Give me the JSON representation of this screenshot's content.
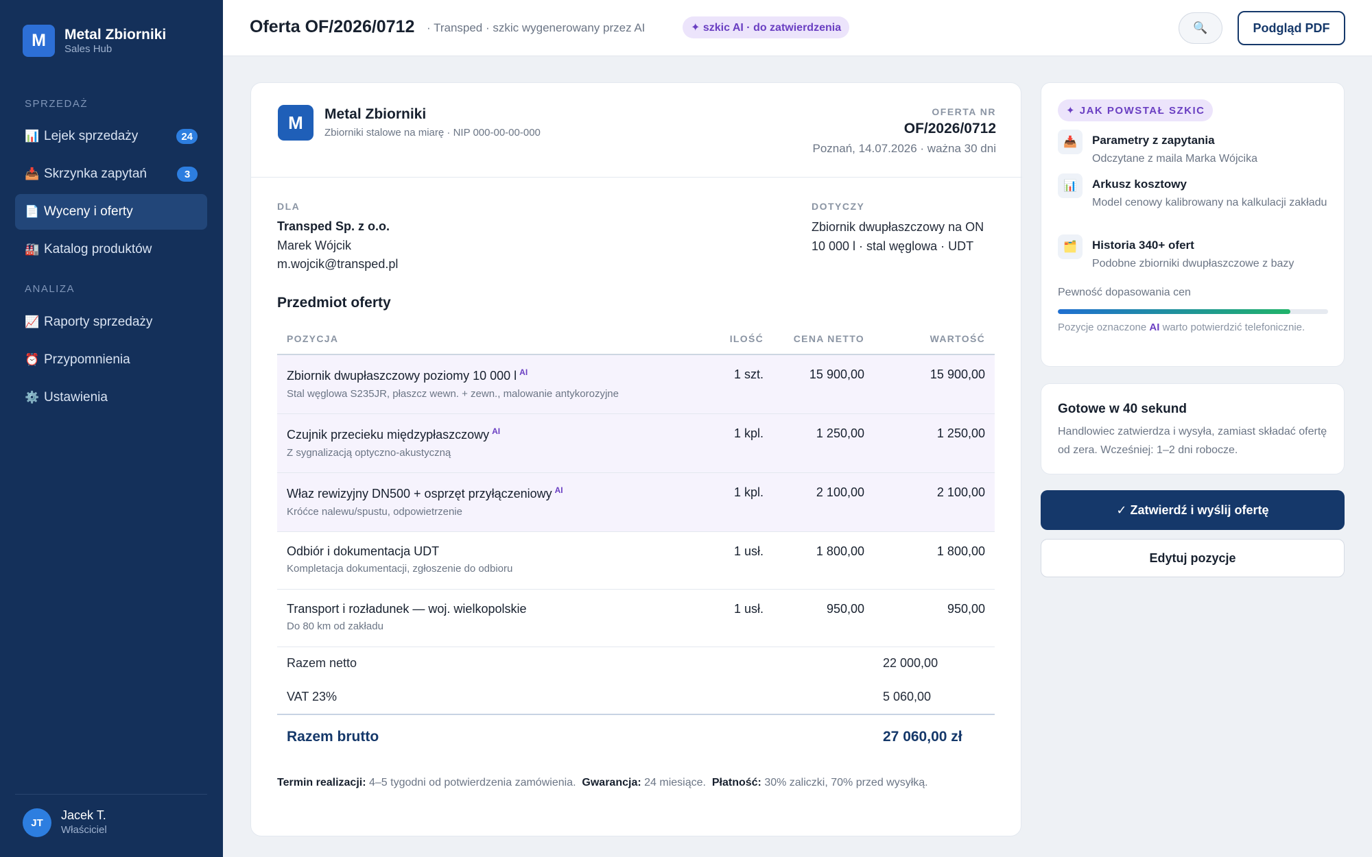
{
  "sidebar": {
    "brand": {
      "logo": "M",
      "name": "Metal Zbiorniki",
      "sub": "Sales Hub"
    },
    "sections": [
      {
        "label": "SPRZEDAŻ"
      },
      {
        "label": "ANALIZA"
      }
    ],
    "items": [
      {
        "icon": "📊",
        "icon_name": "bar-chart-icon",
        "label": "Lejek sprzedaży",
        "badge": "24"
      },
      {
        "icon": "📥",
        "icon_name": "inbox-tray-icon",
        "label": "Skrzynka zapytań",
        "badge": "3"
      },
      {
        "icon": "📄",
        "icon_name": "document-icon",
        "label": "Wyceny i oferty",
        "active": true
      },
      {
        "icon": "🏭",
        "icon_name": "factory-icon",
        "label": "Katalog produktów"
      },
      {
        "icon": "📈",
        "icon_name": "trend-chart-icon",
        "label": "Raporty sprzedaży"
      },
      {
        "icon": "⏰",
        "icon_name": "alarm-clock-icon",
        "label": "Przypomnienia"
      },
      {
        "icon": "⚙️",
        "icon_name": "gear-icon",
        "label": "Ustawienia"
      }
    ],
    "user": {
      "initials": "JT",
      "name": "Jacek T.",
      "role": "Właściciel"
    }
  },
  "header": {
    "title": "Oferta OF/2026/0712",
    "subtitle": "· Transped · szkic wygenerowany przez AI",
    "ai_pill": "✦ szkic AI · do zatwierdzenia",
    "search_icon": "🔍",
    "pdf_button": "Podgląd PDF"
  },
  "document": {
    "logo": "M",
    "company": "Metal Zbiorniki",
    "company_sub": "Zbiorniki stalowe na miarę · NIP 000-00-00-000",
    "offer_no_label": "OFERTA NR",
    "offer_no": "OF/2026/0712",
    "offer_date": "Poznań, 14.07.2026 · ważna 30 dni",
    "to_label": "DLA",
    "to_company": "Transped Sp. z o.o.",
    "to_person": "Marek Wójcik",
    "to_email": "m.wojcik@transped.pl",
    "about_label": "DOTYCZY",
    "about_line1": "Zbiornik dwupłaszczowy na ON",
    "about_line2": "10 000 l · stal węglowa · UDT",
    "section_title": "Przedmiot oferty",
    "columns": {
      "item": "POZYCJA",
      "qty": "ILOŚĆ",
      "price": "CENA NETTO",
      "value": "WARTOŚĆ"
    },
    "ai_tag": "AI",
    "rows": [
      {
        "title": "Zbiornik dwupłaszczowy poziomy 10 000 l",
        "desc": "Stal węglowa S235JR, płaszcz wewn. + zewn., malowanie antykorozyjne",
        "qty": "1 szt.",
        "price": "15 900,00",
        "value": "15 900,00",
        "ai": true
      },
      {
        "title": "Czujnik przecieku międzypłaszczowy",
        "desc": "Z sygnalizacją optyczno-akustyczną",
        "qty": "1 kpl.",
        "price": "1 250,00",
        "value": "1 250,00",
        "ai": true
      },
      {
        "title": "Właz rewizyjny DN500 + osprzęt przyłączeniowy",
        "desc": "Króćce nalewu/spustu, odpowietrzenie",
        "qty": "1 kpl.",
        "price": "2 100,00",
        "value": "2 100,00",
        "ai": true
      },
      {
        "title": "Odbiór i dokumentacja UDT",
        "desc": "Kompletacja dokumentacji, zgłoszenie do odbioru",
        "qty": "1 usł.",
        "price": "1 800,00",
        "value": "1 800,00",
        "ai": false
      },
      {
        "title": "Transport i rozładunek — woj. wielkopolskie",
        "desc": "Do 80 km od zakładu",
        "qty": "1 usł.",
        "price": "950,00",
        "value": "950,00",
        "ai": false
      }
    ],
    "net_label": "Razem netto",
    "net_value": "22 000,00",
    "vat_label": "VAT 23%",
    "vat_value": "5 060,00",
    "gross_label": "Razem brutto",
    "gross_value": "27 060,00 zł",
    "terms": {
      "term_label": "Termin realizacji:",
      "term_value": "4–5 tygodni od potwierdzenia zamówienia.",
      "warranty_label": "Gwarancja:",
      "warranty_value": "24 miesiące.",
      "payment_label": "Płatność:",
      "payment_value": "30% zaliczki, 70% przed wysyłką."
    }
  },
  "how": {
    "pill": "✦ JAK POWSTAŁ SZKIC",
    "steps": [
      {
        "icon": "📥",
        "icon_name": "inbox-tray-icon",
        "title": "Parametry z zapytania",
        "desc": "Odczytane z maila Marka Wójcika"
      },
      {
        "icon": "📊",
        "icon_name": "bar-chart-icon",
        "title": "Arkusz kosztowy",
        "desc": "Model cenowy kalibrowany na kalkulacji zakładu"
      },
      {
        "icon": "🗂️",
        "icon_name": "card-index-icon",
        "title": "Historia 340+ ofert",
        "desc": "Podobne zbiorniki dwupłaszczowe z bazy"
      }
    ],
    "confidence_label": "Pewność dopasowania cen",
    "confidence_fraction": 0.86,
    "note_pre": "Pozycje oznaczone",
    "note_ai": "AI",
    "note_post": "warto potwierdzić telefonicznie."
  },
  "ready": {
    "title": "Gotowe w 40 sekund",
    "desc": "Handlowiec zatwierdza i wysyła, zamiast składać ofertę od zera. Wcześniej: 1–2 dni robocze."
  },
  "actions": {
    "approve": "✓ Zatwierdź i wyślij ofertę",
    "edit": "Edytuj pozycje"
  }
}
